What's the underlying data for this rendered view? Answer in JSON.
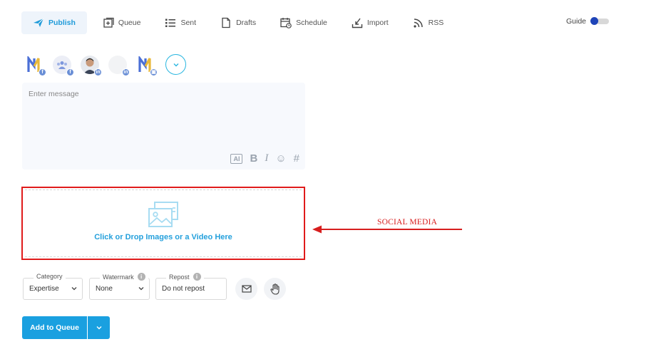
{
  "nav": {
    "items": [
      {
        "label": "Publish",
        "icon": "send-icon",
        "active": true
      },
      {
        "label": "Queue",
        "icon": "queue-icon"
      },
      {
        "label": "Sent",
        "icon": "list-icon"
      },
      {
        "label": "Drafts",
        "icon": "draft-icon"
      },
      {
        "label": "Schedule",
        "icon": "calendar-icon"
      },
      {
        "label": "Import",
        "icon": "import-icon"
      },
      {
        "label": "RSS",
        "icon": "rss-icon"
      }
    ],
    "guide_label": "Guide"
  },
  "accounts": [
    {
      "kind": "brand-logo",
      "network": "f"
    },
    {
      "kind": "group",
      "network": "f"
    },
    {
      "kind": "person-photo",
      "network": "in"
    },
    {
      "kind": "blank",
      "network": "in"
    },
    {
      "kind": "brand-logo",
      "network": "▣"
    }
  ],
  "composer": {
    "placeholder": "Enter message",
    "tools": [
      "AI",
      "B",
      "I",
      "☺",
      "#"
    ]
  },
  "upload": {
    "label": "Click or Drop Images or a Video Here"
  },
  "annotation": {
    "text": "SOCIAL MEDIA",
    "color": "#d71e1e"
  },
  "options": {
    "category": {
      "legend": "Category",
      "value": "Expertise"
    },
    "watermark": {
      "legend": "Watermark",
      "value": "None"
    },
    "repost": {
      "legend": "Repost",
      "value": "Do not repost"
    }
  },
  "actions": {
    "add_label": "Add to Queue"
  },
  "colors": {
    "accent": "#1aa0e0",
    "highlight_box": "#e01b1b",
    "toggle_knob": "#1f44b8"
  }
}
